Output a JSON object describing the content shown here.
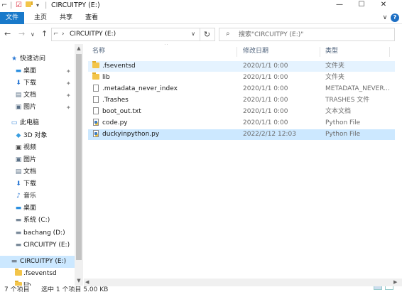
{
  "window": {
    "title": "CIRCUITPY (E:)",
    "min_glyph": "—",
    "max_glyph": "☐",
    "close_glyph": "✕"
  },
  "ribbon": {
    "tabs": [
      "文件",
      "主页",
      "共享",
      "查看"
    ],
    "collapse_glyph": "∨",
    "help_glyph": "?"
  },
  "address": {
    "back_glyph": "←",
    "forward_glyph": "→",
    "recent_glyph": "∨",
    "up_glyph": "↑",
    "separator": "›",
    "path": "CIRCUITPY (E:)",
    "dropdown_glyph": "∨",
    "refresh_glyph": "↻"
  },
  "search": {
    "placeholder": "搜索\"CIRCUITPY (E:)\""
  },
  "nav": {
    "items": [
      {
        "label": "快速访问",
        "icon": "star-icon",
        "glyph": "★",
        "color": "#2b78d4",
        "pinned": false
      },
      {
        "label": "桌面",
        "icon": "desktop-icon",
        "glyph": "▬",
        "color": "#2b8fe0",
        "pinned": true
      },
      {
        "label": "下载",
        "icon": "download-icon",
        "glyph": "⬇",
        "color": "#2b78d4",
        "pinned": true
      },
      {
        "label": "文档",
        "icon": "documents-icon",
        "glyph": "▤",
        "color": "#5a6f86",
        "pinned": true
      },
      {
        "label": "图片",
        "icon": "pictures-icon",
        "glyph": "▣",
        "color": "#5a6f86",
        "pinned": true
      },
      {
        "label": "此电脑",
        "icon": "this-pc-icon",
        "glyph": "▭",
        "color": "#3a88d8",
        "pinned": false
      },
      {
        "label": "3D 对象",
        "icon": "3d-objects-icon",
        "glyph": "◆",
        "color": "#3a9ee0",
        "pinned": false
      },
      {
        "label": "视频",
        "icon": "videos-icon",
        "glyph": "▣",
        "color": "#4b4b4b",
        "pinned": false
      },
      {
        "label": "图片",
        "icon": "pictures-icon",
        "glyph": "▣",
        "color": "#5a6f86",
        "pinned": false
      },
      {
        "label": "文档",
        "icon": "documents-icon",
        "glyph": "▤",
        "color": "#5a6f86",
        "pinned": false
      },
      {
        "label": "下载",
        "icon": "download-icon",
        "glyph": "⬇",
        "color": "#2b78d4",
        "pinned": false
      },
      {
        "label": "音乐",
        "icon": "music-icon",
        "glyph": "♪",
        "color": "#2b78d4",
        "pinned": false
      },
      {
        "label": "桌面",
        "icon": "desktop-icon",
        "glyph": "▬",
        "color": "#2b8fe0",
        "pinned": false
      },
      {
        "label": "系统 (C:)",
        "icon": "drive-icon",
        "glyph": "▬",
        "color": "#7a8a9a",
        "pinned": false
      },
      {
        "label": "bachang (D:)",
        "icon": "drive-icon",
        "glyph": "▬",
        "color": "#7a8a9a",
        "pinned": false
      },
      {
        "label": "CIRCUITPY (E:)",
        "icon": "usb-drive-icon",
        "glyph": "▬",
        "color": "#7a8a9a",
        "pinned": false
      },
      {
        "label": "CIRCUITPY (E:)",
        "icon": "usb-drive-icon",
        "glyph": "▬",
        "color": "#7a8a9a",
        "pinned": false,
        "selected": true
      },
      {
        "label": ".fseventsd",
        "icon": "folder-icon",
        "glyph": "",
        "color": "#f3c54a",
        "pinned": false
      },
      {
        "label": "lib",
        "icon": "folder-icon",
        "glyph": "",
        "color": "#f3c54a",
        "pinned": false
      }
    ],
    "pin_glyph": "✦"
  },
  "columns": {
    "name": "名称",
    "date": "修改日期",
    "type": "类型",
    "sort_glyph": "^"
  },
  "files": [
    {
      "name": ".fseventsd",
      "date": "2020/1/1 0:00",
      "type": "文件夹",
      "kind": "folder",
      "state": "hover"
    },
    {
      "name": "lib",
      "date": "2020/1/1 0:00",
      "type": "文件夹",
      "kind": "folder",
      "state": ""
    },
    {
      "name": ".metadata_never_index",
      "date": "2020/1/1 0:00",
      "type": "METADATA_NEVER...",
      "kind": "doc",
      "state": ""
    },
    {
      "name": ".Trashes",
      "date": "2020/1/1 0:00",
      "type": "TRASHES 文件",
      "kind": "doc",
      "state": ""
    },
    {
      "name": "boot_out.txt",
      "date": "2020/1/1 0:00",
      "type": "文本文档",
      "kind": "doc",
      "state": ""
    },
    {
      "name": "code.py",
      "date": "2020/1/1 0:00",
      "type": "Python File",
      "kind": "py",
      "state": ""
    },
    {
      "name": "duckyinpython.py",
      "date": "2022/2/12 12:03",
      "type": "Python File",
      "kind": "py",
      "state": "selected"
    }
  ],
  "status": {
    "count": "7 个项目",
    "selection": "选中 1 个项目  5.00 KB"
  },
  "colors": {
    "file_tab": "#1979ca",
    "selection": "#cce8ff",
    "hover": "#e5f3ff"
  }
}
